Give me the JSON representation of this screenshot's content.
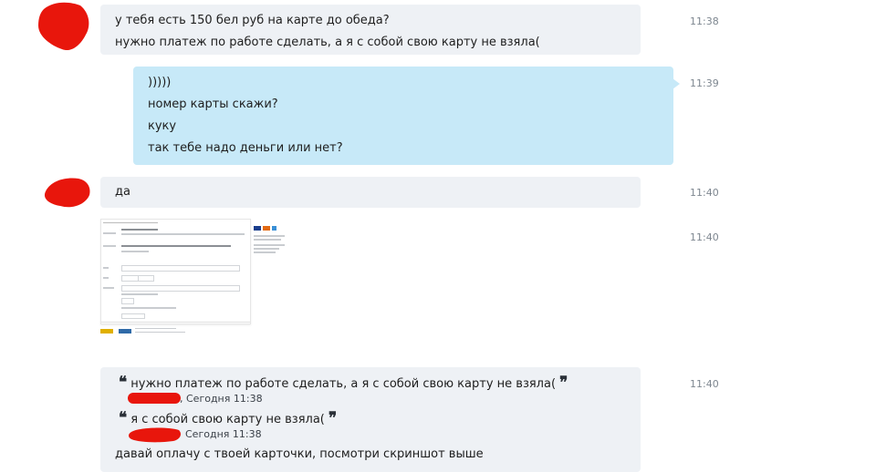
{
  "messages": [
    {
      "lines": [
        "у тебя есть 150 бел руб на карте до обеда?",
        "нужно платеж по работе сделать, а я с собой свою карту не взяла("
      ],
      "time": "11:38"
    },
    {
      "lines": [
        ")))))",
        "номер карты  скажи?",
        "куку",
        "так тебе надо деньги или нет?"
      ],
      "time": "11:39"
    },
    {
      "lines": [
        "да"
      ],
      "time": "11:40"
    },
    {
      "attachment": "screenshot-image",
      "time": "11:40"
    },
    {
      "quotes": [
        {
          "text": "нужно платеж по работе сделать, а я с собой свою карту не взяла(",
          "meta": ", Сегодня 11:38"
        },
        {
          "text": "я с собой свою карту не взяла(",
          "meta": "Сегодня 11:38"
        }
      ],
      "reply": "давай оплачу с твоей карточки, посмотри скриншот выше",
      "time": "11:40"
    }
  ],
  "colors": {
    "incoming": "#eef1f5",
    "outgoing": "#c7e9f8",
    "redaction": "#e8160c",
    "timestamp": "#7e8790"
  },
  "icons": {
    "open_quote": "❝",
    "close_quote": "❞"
  }
}
